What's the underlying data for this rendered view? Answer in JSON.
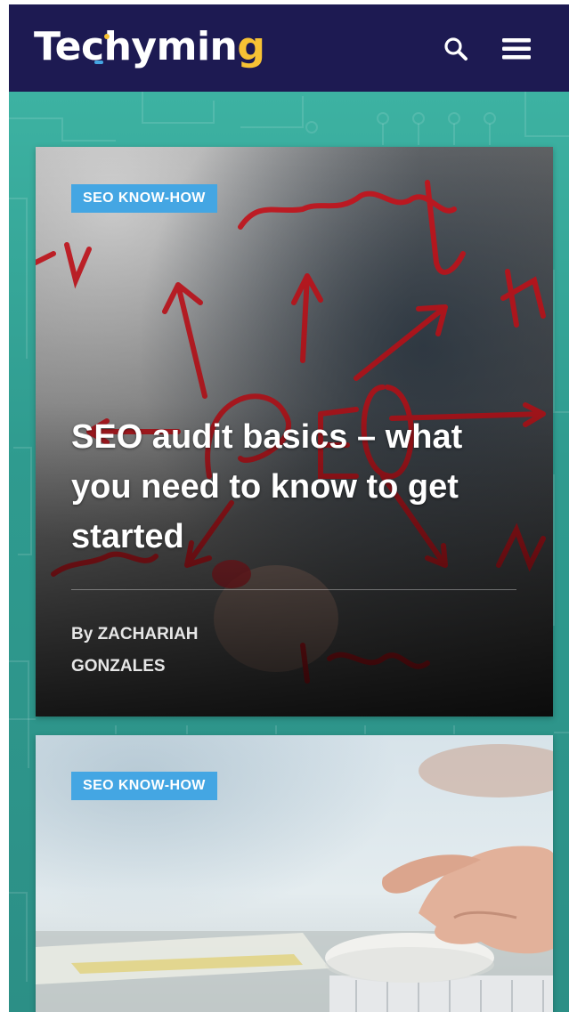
{
  "header": {
    "logo_text_main": "Techymin",
    "logo_text_g": "g",
    "search_icon": "search-icon",
    "menu_icon": "hamburger-menu-icon"
  },
  "colors": {
    "header_bg": "#1d1a52",
    "teal_bg": "#3aa79a",
    "badge_bg": "#44a6e3",
    "logo_accent": "#f7c234"
  },
  "posts": [
    {
      "category": "SEO KNOW-HOW",
      "title": "SEO audit basics – what you need to know to get started",
      "by_label": "By",
      "author": "ZACHARIAH GONZALES"
    },
    {
      "category": "SEO KNOW-HOW"
    }
  ]
}
